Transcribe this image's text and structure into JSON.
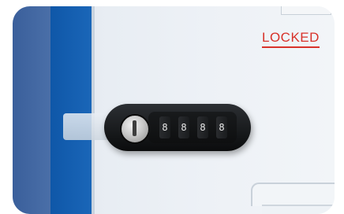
{
  "label": {
    "text": "LOCKED",
    "color": "#d8322a"
  },
  "lock": {
    "type": "combination cabinet lock with key override",
    "dials": [
      "8",
      "8",
      "8",
      "8"
    ]
  },
  "colors": {
    "stripe_dark": "#3a5f9b",
    "stripe_blue": "#0f57a8",
    "cabinet": "#edf1f6",
    "lock_body": "#141618"
  }
}
